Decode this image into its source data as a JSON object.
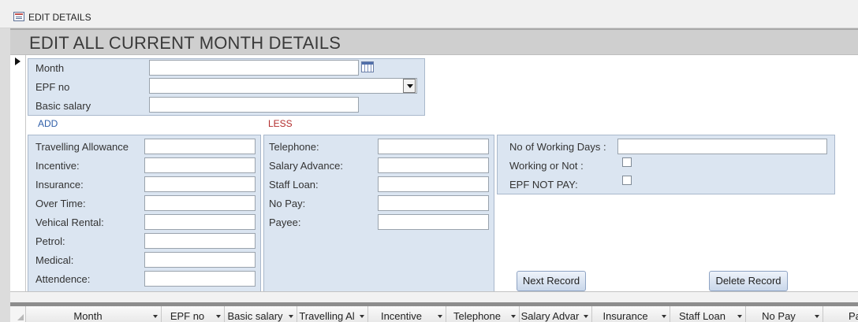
{
  "window": {
    "title": "EDIT DETAILS"
  },
  "form": {
    "title": "EDIT ALL CURRENT MONTH DETAILS"
  },
  "top_panel": {
    "month_label": "Month",
    "month_value": "",
    "epf_label": "EPF no",
    "epf_value": "",
    "basic_label": "Basic salary",
    "basic_value": ""
  },
  "sections": {
    "add": "ADD",
    "less": "LESS"
  },
  "add_fields": [
    {
      "label": "Travelling Allowance",
      "value": ""
    },
    {
      "label": "Incentive:",
      "value": ""
    },
    {
      "label": "Insurance:",
      "value": ""
    },
    {
      "label": "Over Time:",
      "value": ""
    },
    {
      "label": "Vehical Rental:",
      "value": ""
    },
    {
      "label": "Petrol:",
      "value": ""
    },
    {
      "label": "Medical:",
      "value": ""
    },
    {
      "label": "Attendence:",
      "value": ""
    }
  ],
  "less_fields": [
    {
      "label": "Telephone:",
      "value": ""
    },
    {
      "label": "Salary Advance:",
      "value": ""
    },
    {
      "label": "Staff Loan:",
      "value": ""
    },
    {
      "label": "No Pay:",
      "value": ""
    },
    {
      "label": "Payee:",
      "value": ""
    }
  ],
  "working_panel": {
    "days_label": "No of Working Days :",
    "days_value": "",
    "working_label": "Working or Not :",
    "epf_not_pay_label": "EPF NOT PAY:"
  },
  "buttons": {
    "next": "Next Record",
    "delete": "Delete Record"
  },
  "datasheet_columns": [
    "Month",
    "EPF no",
    "Basic salary",
    "Travelling Al",
    "Incentive",
    "Telephone",
    "Salary Advar",
    "Insurance",
    "Staff Loan",
    "No Pay",
    "Paye"
  ],
  "colors": {
    "panel": "#dbe5f1",
    "add_accent": "#2e5ea8",
    "less_accent": "#b22b2b"
  }
}
